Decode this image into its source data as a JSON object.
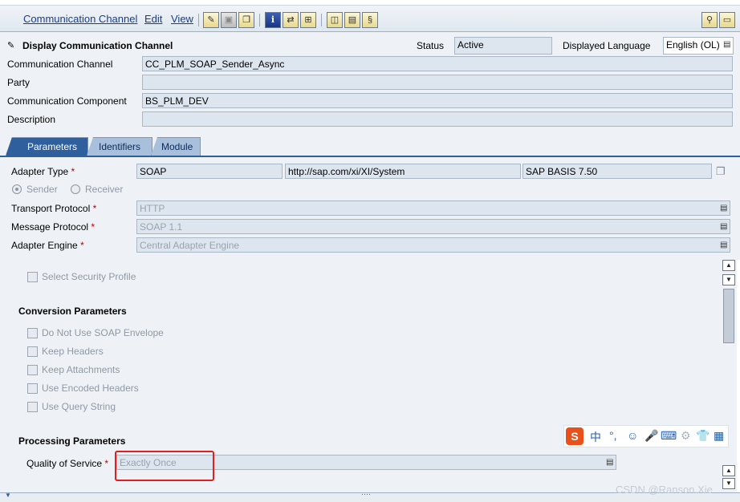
{
  "menubar": {
    "items": [
      "Communication Channel",
      "Edit",
      "View"
    ],
    "toolbar_icons": [
      "edit-icon",
      "save-icon",
      "copy-icon",
      "info-icon",
      "where-used-icon",
      "compare-icon",
      "display-icon",
      "table-icon",
      "history-icon",
      "broom-icon",
      "window-icon"
    ]
  },
  "header": {
    "title": "Display Communication Channel",
    "status_label": "Status",
    "status_value": "Active",
    "language_label": "Displayed Language",
    "language_value": "English (OL)",
    "fields": [
      {
        "label": "Communication Channel",
        "value": "CC_PLM_SOAP_Sender_Async"
      },
      {
        "label": "Party",
        "value": ""
      },
      {
        "label": "Communication Component",
        "value": "BS_PLM_DEV"
      },
      {
        "label": "Description",
        "value": ""
      }
    ]
  },
  "tabs": [
    {
      "label": "Parameters",
      "active": true
    },
    {
      "label": "Identifiers",
      "active": false
    },
    {
      "label": "Module",
      "active": false
    }
  ],
  "parameters": {
    "adapter_type_label": "Adapter Type",
    "adapter_type": "SOAP",
    "adapter_namespace": "http://sap.com/xi/XI/System",
    "adapter_swc": "SAP BASIS 7.50",
    "sender_label": "Sender",
    "receiver_label": "Receiver",
    "transport_protocol_label": "Transport Protocol",
    "transport_protocol": "HTTP",
    "message_protocol_label": "Message Protocol",
    "message_protocol": "SOAP 1.1",
    "adapter_engine_label": "Adapter Engine",
    "adapter_engine": "Central Adapter Engine",
    "required_mark": "*"
  },
  "security": {
    "checkbox": "Select Security Profile"
  },
  "conversion": {
    "title": "Conversion Parameters",
    "options": [
      "Do Not Use SOAP Envelope",
      "Keep Headers",
      "Keep Attachments",
      "Use Encoded Headers",
      "Use Query String"
    ]
  },
  "processing": {
    "title": "Processing Parameters",
    "qos_label": "Quality of Service",
    "qos_value": "Exactly Once"
  },
  "ime": {
    "symbols": [
      "中",
      "°,",
      "☺",
      "🎤",
      "⌨",
      "👕",
      "▦"
    ]
  },
  "watermark": "CSDN @Ranson.Xie",
  "colors": {
    "accent": "#2f5f9c",
    "required": "#c00000",
    "highlight_box": "#e02020"
  }
}
